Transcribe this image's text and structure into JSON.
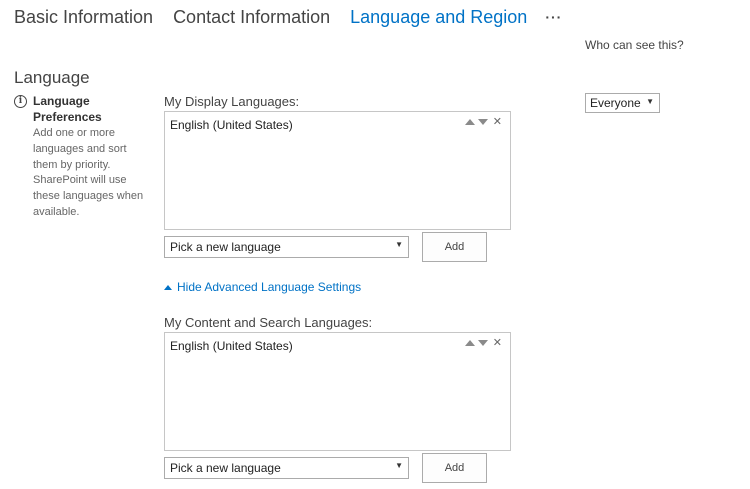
{
  "tabs": {
    "basic": "Basic Information",
    "contact": "Contact Information",
    "language": "Language and Region",
    "more": "···"
  },
  "visibility": {
    "label": "Who can see this?",
    "value": "Everyone",
    "arrow": "▼"
  },
  "section": {
    "title": "Language"
  },
  "preferences": {
    "info_glyph": "i",
    "title": "Language Preferences",
    "description": "Add one or more languages and sort them by priority. SharePoint will use these languages when available."
  },
  "display_languages": {
    "label": "My Display Languages:",
    "items": [
      "English (United States)"
    ],
    "remove_glyph": "✕",
    "picker": "Pick a new language",
    "picker_arrow": "▼",
    "add": "Add"
  },
  "advanced": {
    "link": "Hide Advanced Language Settings"
  },
  "content_languages": {
    "label": "My Content and Search Languages:",
    "items": [
      "English (United States)"
    ],
    "remove_glyph": "✕",
    "picker": "Pick a new language",
    "picker_arrow": "▼",
    "add": "Add"
  },
  "colors": {
    "accent": "#0072c6",
    "text": "#444444",
    "border": "#c6c6c6"
  }
}
